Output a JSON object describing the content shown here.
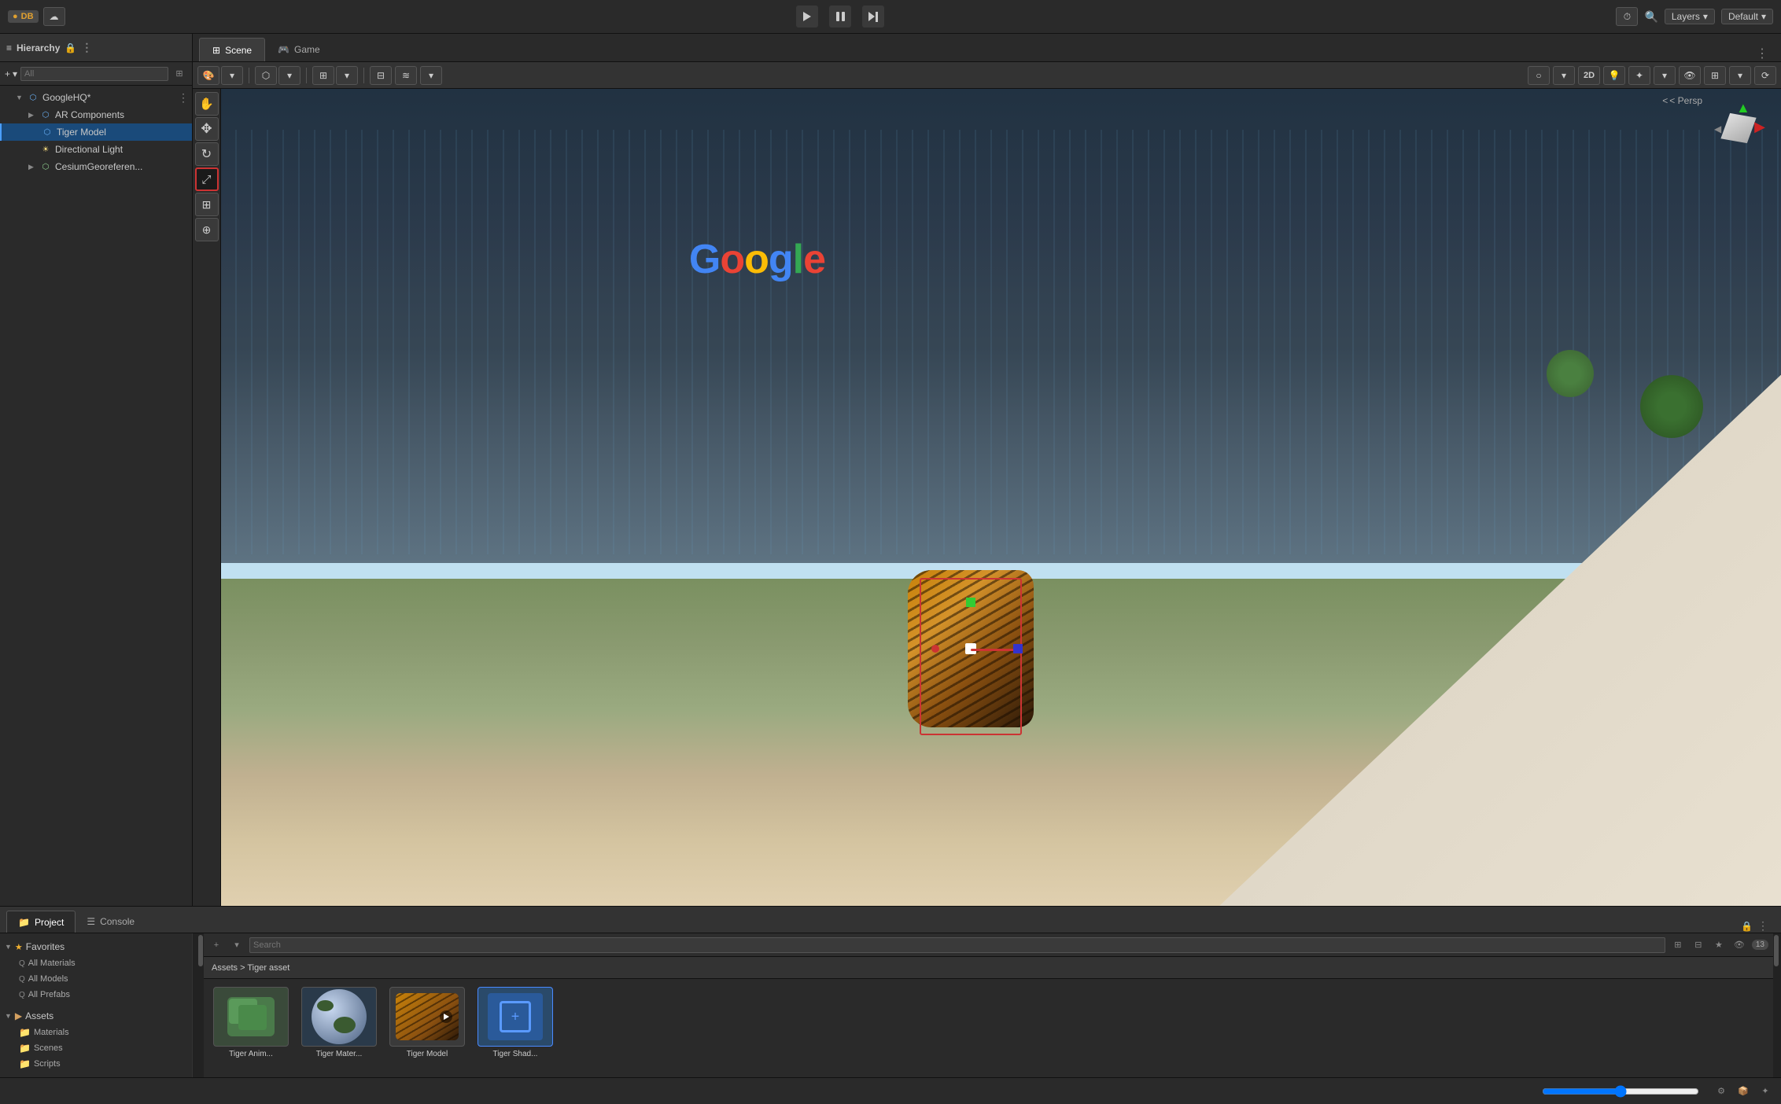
{
  "topbar": {
    "db_label": "DB",
    "play_label": "▶",
    "pause_label": "⏸",
    "step_label": "⏭",
    "layers_label": "Layers",
    "default_label": "Default",
    "search_placeholder": "Search"
  },
  "hierarchy": {
    "title": "Hierarchy",
    "search_placeholder": "All",
    "items": [
      {
        "label": "GoogleHQ*",
        "level": 0,
        "has_arrow": true,
        "icon": "cube"
      },
      {
        "label": "AR Components",
        "level": 1,
        "has_arrow": true,
        "icon": "cube"
      },
      {
        "label": "Tiger Model",
        "level": 1,
        "has_arrow": false,
        "icon": "cube",
        "selected": true
      },
      {
        "label": "Directional Light",
        "level": 1,
        "has_arrow": false,
        "icon": "light"
      },
      {
        "label": "CesiumGeoreferen...",
        "level": 1,
        "has_arrow": true,
        "icon": "geo"
      }
    ]
  },
  "scene": {
    "tab_scene": "Scene",
    "tab_game": "Game",
    "persp_label": "< Persp"
  },
  "tools": {
    "hand": "✋",
    "move": "✥",
    "rotate": "↻",
    "scale": "⤢",
    "rect": "⊞",
    "transform": "⊕"
  },
  "bottom": {
    "tab_project": "Project",
    "tab_console": "Console",
    "favorites_label": "Favorites",
    "favorites_items": [
      "All Materials",
      "All Models",
      "All Prefabs"
    ],
    "assets_label": "Assets",
    "assets_items": [
      "Materials",
      "Scenes",
      "Scripts"
    ],
    "breadcrumb": "Assets > Tiger asset",
    "asset_cards": [
      {
        "label": "Tiger Anim...",
        "type": "anim"
      },
      {
        "label": "Tiger Mater...",
        "type": "material"
      },
      {
        "label": "Tiger Model",
        "type": "model"
      },
      {
        "label": "Tiger Shad...",
        "type": "shader"
      }
    ],
    "count_badge": "13"
  },
  "statusbar": {
    "icons": [
      "⚙",
      "📦",
      "✦"
    ]
  }
}
